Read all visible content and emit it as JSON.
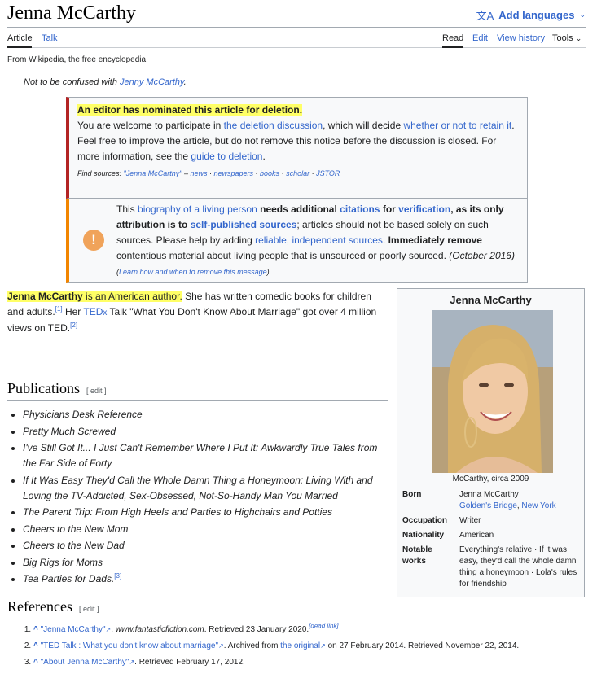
{
  "header": {
    "title": "Jenna McCarthy",
    "languages_label": "Add languages"
  },
  "tabs": {
    "article": "Article",
    "talk": "Talk",
    "read": "Read",
    "edit": "Edit",
    "view_history": "View history",
    "tools": "Tools"
  },
  "from_line": "From Wikipedia, the free encyclopedia",
  "hatnote": {
    "prefix": "Not to be confused with ",
    "link": "Jenny McCarthy",
    "suffix": "."
  },
  "afd": {
    "heading": "An editor has nominated this article for deletion.",
    "l1_a": "You are welcome to participate in ",
    "l1_link1": "the deletion discussion",
    "l1_b": ", which will decide ",
    "l1_link2": "whether or not to retain it",
    "l1_c": ".",
    "l2_a": "Feel free to improve the article, but do not remove this notice before the discussion is closed. For more information, see the ",
    "l2_link": "guide to deletion",
    "l2_b": ".",
    "find_label": "Find sources:",
    "find_query": "\"Jenna McCarthy\"",
    "find_dash": " – ",
    "find_sources": [
      "news",
      "newspapers",
      "books",
      "scholar",
      "JSTOR"
    ]
  },
  "blp": {
    "t1": "This ",
    "link_blp": "biography of a living person",
    "t2": " needs additional ",
    "link_citations": "citations",
    "t3": " for ",
    "link_verification": "verification",
    "t4": ", as its only attribution is to ",
    "link_self": "self-published sources",
    "t5": "; articles should not be based solely on such sources. Please help by adding ",
    "link_reliable": "reliable, independent sources",
    "t6": ". ",
    "t7": "Immediately remove",
    "t8": " contentious material about living people that is unsourced or poorly sourced.",
    "date": "(October 2016)",
    "learn_open": "(",
    "learn_link": "Learn how and when to remove this message",
    "learn_close": ")"
  },
  "lead": {
    "hl_name": "Jenna McCarthy",
    "hl_rest": " is an American author.",
    "t1": " She has written comedic books for children and adults.",
    "ref1": "[1]",
    "t2": " Her ",
    "ted_link": "TED",
    "ted_x": "x",
    "t3": " Talk \"What You Don't Know About Marriage\" got over 4 million views on TED.",
    "ref2": "[2]"
  },
  "infobox": {
    "title": "Jenna McCarthy",
    "caption": "McCarthy, circa 2009",
    "born_label": "Born",
    "born_name": "Jenna McCarthy",
    "born_place1": "Golden's Bridge",
    "born_sep": ", ",
    "born_place2": "New York",
    "occupation_label": "Occupation",
    "occupation": "Writer",
    "nationality_label": "Nationality",
    "nationality": "American",
    "notable_label1": "Notable",
    "notable_label2": "works",
    "notable": "Everything's relative · If it was easy, they'd call the whole damn thing a honeymoon · Lola's rules for friendship"
  },
  "publications": {
    "heading": "Publications",
    "edit": "[ edit ]",
    "items": [
      "Physicians Desk Reference",
      "Pretty Much Screwed",
      "I've Still Got It... I Just Can't Remember Where I Put It: Awkwardly True Tales from the Far Side of Forty",
      "If It Was Easy They'd Call the Whole Damn Thing a Honeymoon: Living With and Loving the TV-Addicted, Sex-Obsessed, Not-So-Handy Man You Married",
      "The Parent Trip: From High Heels and Parties to Highchairs and Potties",
      "Cheers to the New Mom",
      "Cheers to the New Dad",
      "Big Rigs for Moms",
      "Tea Parties for Dads."
    ],
    "last_ref": "[3]"
  },
  "references": {
    "heading": "References",
    "edit": "[ edit ]",
    "r1_link": "\"Jenna McCarthy\"",
    "r1_site": "www.fantasticfiction.com",
    "r1_text": ". Retrieved 23 January 2020.",
    "r1_dead": "[dead link]",
    "r2_link": "\"TED Talk : What you don't know about marriage\"",
    "r2_a": ". Archived from ",
    "r2_orig": "the original",
    "r2_b": " on 27 February 2014. Retrieved November 22, 2014.",
    "r3_link": "\"About Jenna McCarthy\"",
    "r3_text": ". Retrieved February 17, 2012."
  }
}
